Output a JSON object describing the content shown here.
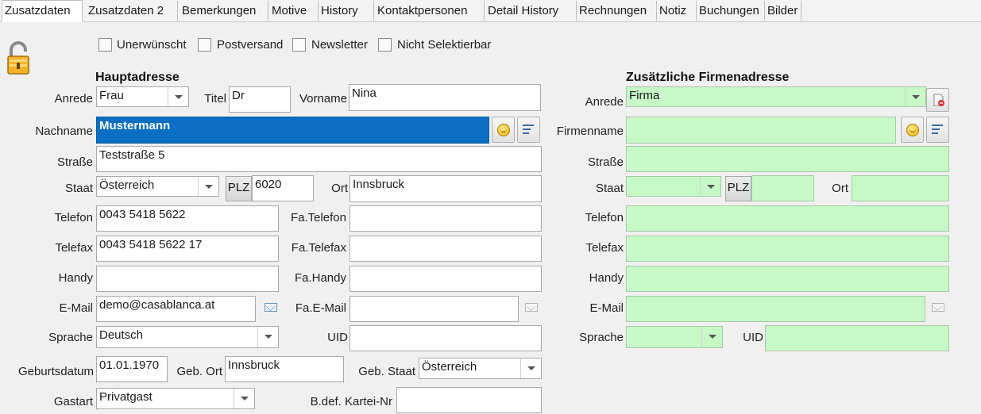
{
  "tabs": [
    {
      "label": "Zusatzdaten",
      "active": true
    },
    {
      "label": "Zusatzdaten 2"
    },
    {
      "label": "Bemerkungen"
    },
    {
      "label": "Motive"
    },
    {
      "label": "History"
    },
    {
      "label": "Kontaktpersonen"
    },
    {
      "label": "Detail History"
    },
    {
      "label": "Rechnungen"
    },
    {
      "label": "Notiz"
    },
    {
      "label": "Buchungen"
    },
    {
      "label": "Bilder"
    }
  ],
  "checkboxes": {
    "unerwuenscht": "Unerwünscht",
    "postversand": "Postversand",
    "newsletter": "Newsletter",
    "nicht_selektierbar": "Nicht Selektierbar"
  },
  "main": {
    "heading": "Hauptadresse",
    "labels": {
      "anrede": "Anrede",
      "titel": "Titel",
      "vorname": "Vorname",
      "nachname": "Nachname",
      "strasse": "Straße",
      "staat": "Staat",
      "plz": "PLZ",
      "ort": "Ort",
      "telefon": "Telefon",
      "fa_telefon": "Fa.Telefon",
      "telefax": "Telefax",
      "fa_telefax": "Fa.Telefax",
      "handy": "Handy",
      "fa_handy": "Fa.Handy",
      "email": "E-Mail",
      "fa_email": "Fa.E-Mail",
      "sprache": "Sprache",
      "uid": "UID",
      "geburtsdatum": "Geburtsdatum",
      "geb_ort": "Geb. Ort",
      "geb_staat": "Geb. Staat",
      "gastart": "Gastart",
      "kartei_nr": "B.def. Kartei-Nr"
    },
    "values": {
      "anrede": "Frau",
      "titel": "Dr",
      "vorname": "Nina",
      "nachname": "Mustermann",
      "strasse": "Teststraße 5",
      "staat": "Österreich",
      "plz": "6020",
      "ort": "Innsbruck",
      "telefon": "0043 5418 5622",
      "fa_telefon": "",
      "telefax": "0043 5418 5622 17",
      "fa_telefax": "",
      "handy": "",
      "fa_handy": "",
      "email": "demo@casablanca.at",
      "fa_email": "",
      "sprache": "Deutsch",
      "uid": "",
      "geburtsdatum": "01.01.1970",
      "geb_ort": "Innsbruck",
      "geb_staat": "Österreich",
      "gastart": "Privatgast",
      "kartei_nr": ""
    }
  },
  "company": {
    "heading": "Zusätzliche Firmenadresse",
    "labels": {
      "anrede": "Anrede",
      "firmenname": "Firmenname",
      "strasse": "Straße",
      "staat": "Staat",
      "plz": "PLZ",
      "ort": "Ort",
      "telefon": "Telefon",
      "telefax": "Telefax",
      "handy": "Handy",
      "email": "E-Mail",
      "sprache": "Sprache",
      "uid": "UID"
    },
    "values": {
      "anrede": "Firma",
      "firmenname": "",
      "strasse": "",
      "staat": "",
      "plz": "",
      "ort": "",
      "telefon": "",
      "telefax": "",
      "handy": "",
      "email": "",
      "sprache": "",
      "uid": ""
    }
  },
  "icons": {
    "lock": "unlocked-padlock-icon",
    "nachname_smiley": "smiley-icon",
    "nachname_edit": "edit-list-icon",
    "firma_delete": "delete-document-icon",
    "firma_smiley": "smiley-icon",
    "firma_edit": "edit-list-icon",
    "mail": "mail-icon"
  },
  "colors": {
    "selection": "#0a6fc2",
    "company_field": "#c6f9c6"
  }
}
